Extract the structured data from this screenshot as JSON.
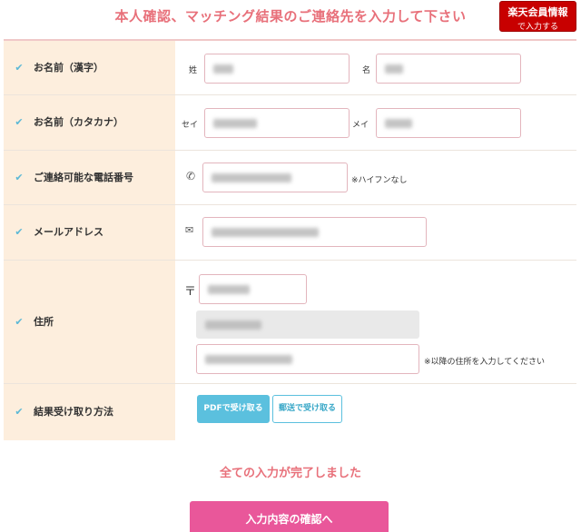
{
  "header": {
    "title": "本人確認、マッチング結果のご連絡先を入力して下さい",
    "rakuten_button": {
      "line1": "楽天会員情報",
      "line2": "で入力する"
    }
  },
  "rows": {
    "name_kanji": {
      "label": "お名前（漢字）",
      "last_label": "姓",
      "first_label": "名"
    },
    "name_kana": {
      "label": "お名前（カタカナ）",
      "last_label": "セイ",
      "first_label": "メイ"
    },
    "phone": {
      "label": "ご連絡可能な電話番号",
      "icon": "phone-icon",
      "note": "※ハイフンなし"
    },
    "email": {
      "label": "メールアドレス",
      "icon": "envelope-icon"
    },
    "address": {
      "label": "住所",
      "postal_symbol": "〒",
      "note": "※以降の住所を入力してください"
    },
    "result_method": {
      "label": "結果受け取り方法",
      "pdf_button": "PDFで受け取る",
      "mail_button": "郵送で受け取る"
    }
  },
  "status": {
    "complete_message": "全ての入力が完了しました"
  },
  "confirm_button": "入力内容の確認へ",
  "colors": {
    "accent_pink": "#e8707a",
    "check_blue": "#5bb8d6",
    "label_bg": "#fdeedd",
    "confirm_bg": "#e9579a",
    "rakuten_red": "#c80000"
  }
}
